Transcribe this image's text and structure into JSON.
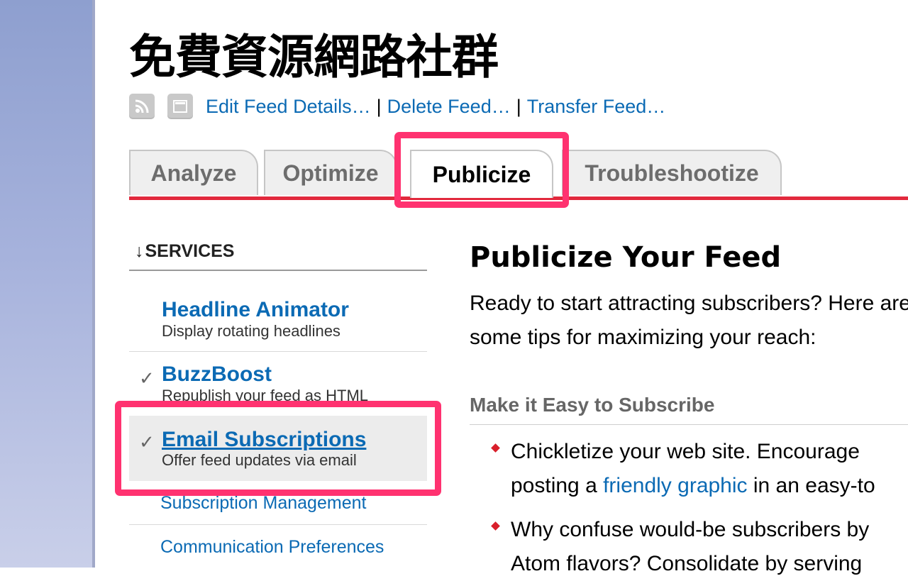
{
  "feed": {
    "title": "免費資源網路社群",
    "actions": [
      "Edit Feed Details…",
      "Delete Feed…",
      "Transfer Feed…"
    ],
    "separator": "|",
    "icons": [
      "rss-feed-icon",
      "window-icon"
    ]
  },
  "tabs": [
    {
      "label": "Analyze",
      "active": false
    },
    {
      "label": "Optimize",
      "active": false
    },
    {
      "label": "Publicize",
      "active": true
    },
    {
      "label": "Troubleshootize",
      "active": false
    }
  ],
  "sidebar": {
    "arrow": "↓",
    "heading": "SERVICES",
    "check_mark": "✓",
    "services": [
      {
        "title": "Headline Animator",
        "description": "Display rotating headlines",
        "checked": false
      },
      {
        "title": "BuzzBoost",
        "description": "Republish your feed as HTML",
        "checked": true
      },
      {
        "title": "Email Subscriptions",
        "description": "Offer feed updates via email",
        "checked": true,
        "selected": true
      }
    ],
    "sub_links": [
      "Subscription Management",
      "Communication Preferences"
    ]
  },
  "main": {
    "title": "Publicize Your Feed",
    "intro": "Ready to start attracting subscribers? Here are some tips for maximizing your reach:",
    "section_heading": "Make it Easy to Subscribe",
    "bullets": [
      {
        "line1": "Chickletize your web site. Encourage",
        "line2_before": "posting a ",
        "line2_link": "friendly graphic",
        "line2_after": " in an easy-to"
      },
      {
        "line1": "Why confuse would-be subscribers by",
        "line2": "Atom flavors? Consolidate by serving"
      }
    ]
  },
  "colors": {
    "accent_link": "#0b6ab4",
    "tab_rule": "#e2293d",
    "highlight": "#ff3270",
    "left_rail": "#8e9fcf"
  }
}
